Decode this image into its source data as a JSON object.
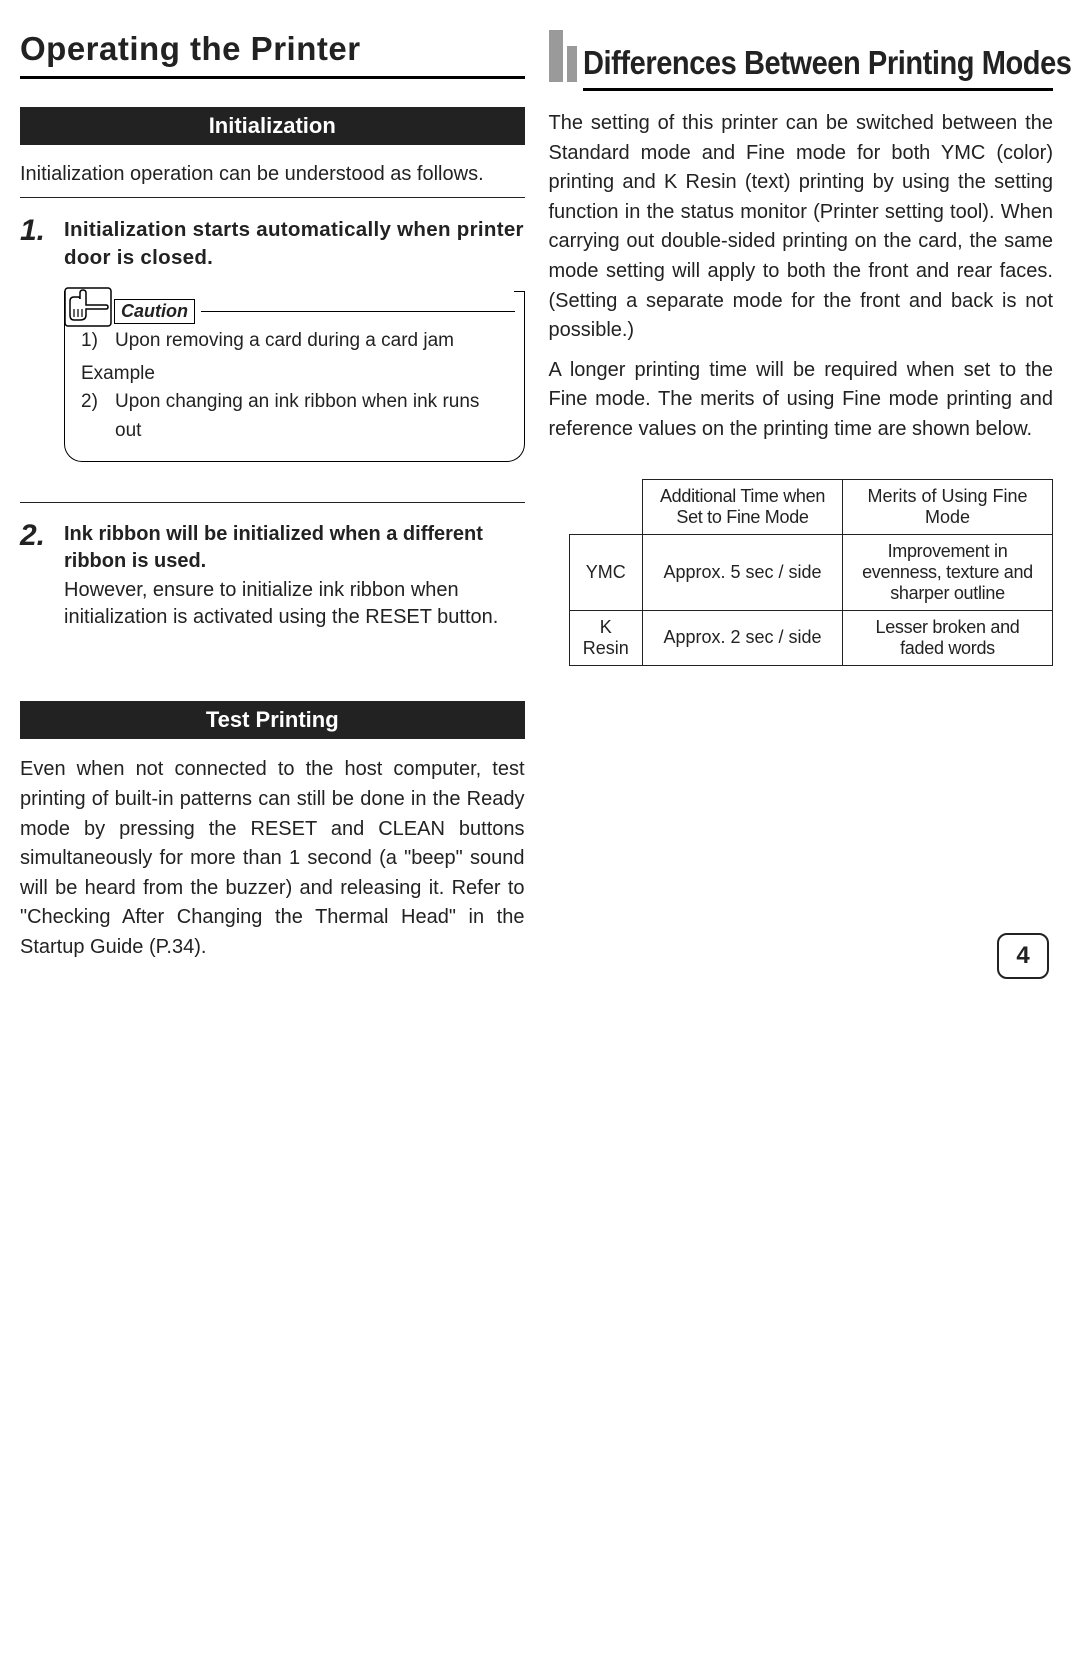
{
  "left": {
    "title": "Operating the Printer",
    "sections": {
      "initialization": {
        "heading": "Initialization",
        "lead": "Initialization operation can be understood as follows.",
        "steps": [
          {
            "num": "1.",
            "bold": "Initialization starts automatically when printer door is closed."
          },
          {
            "num": "2.",
            "bold": "Ink ribbon will be initialized when a different ribbon is used.",
            "regular": "However, ensure to initialize ink ribbon when initialization is activated using the RESET button."
          }
        ],
        "caution": {
          "label": "Caution",
          "items": [
            {
              "marker": "1)",
              "text": "Upon removing a card during a card jam"
            },
            {
              "example": "Example"
            },
            {
              "marker": "2)",
              "text": "Upon changing an ink ribbon when ink runs out"
            }
          ]
        }
      },
      "test_printing": {
        "heading": "Test Printing",
        "body": "Even when not connected to the host computer, test printing of built-in patterns can still be done in the Ready mode by pressing the RESET and CLEAN buttons simultaneously for more than 1 second (a \"beep\" sound will be heard from the buzzer) and releasing it. Refer to \"Checking After Changing the Thermal Head\" in the Startup Guide (P.34)."
      }
    }
  },
  "right": {
    "title": "Differences Between Printing Modes",
    "para1": "The setting of this printer can be switched between the Standard mode and Fine mode for both YMC (color) printing and K Resin (text) printing by using the setting function in the status monitor (Printer setting tool). When carrying out double-sided printing on the card, the same mode setting will apply to both the front and rear faces. (Setting a separate mode for the front and back is not possible.)",
    "para2": "A longer printing time will be required when set to the Fine mode. The merits of using Fine mode printing and reference values on the printing time are shown below.",
    "table": {
      "headers": {
        "time": "Additional Time when Set to Fine Mode",
        "merits": "Merits of Using Fine Mode"
      }
    }
  },
  "chart_data": {
    "type": "table",
    "headers": [
      "",
      "Additional Time when Set to Fine Mode",
      "Merits of Using Fine Mode"
    ],
    "rows": [
      {
        "label": "YMC",
        "time": "Approx. 5 sec / side",
        "merits": "Improvement in evenness, texture and sharper outline"
      },
      {
        "label": "K Resin",
        "time": "Approx. 2 sec / side",
        "merits": "Lesser broken and faded words"
      }
    ]
  },
  "page_number": "4"
}
